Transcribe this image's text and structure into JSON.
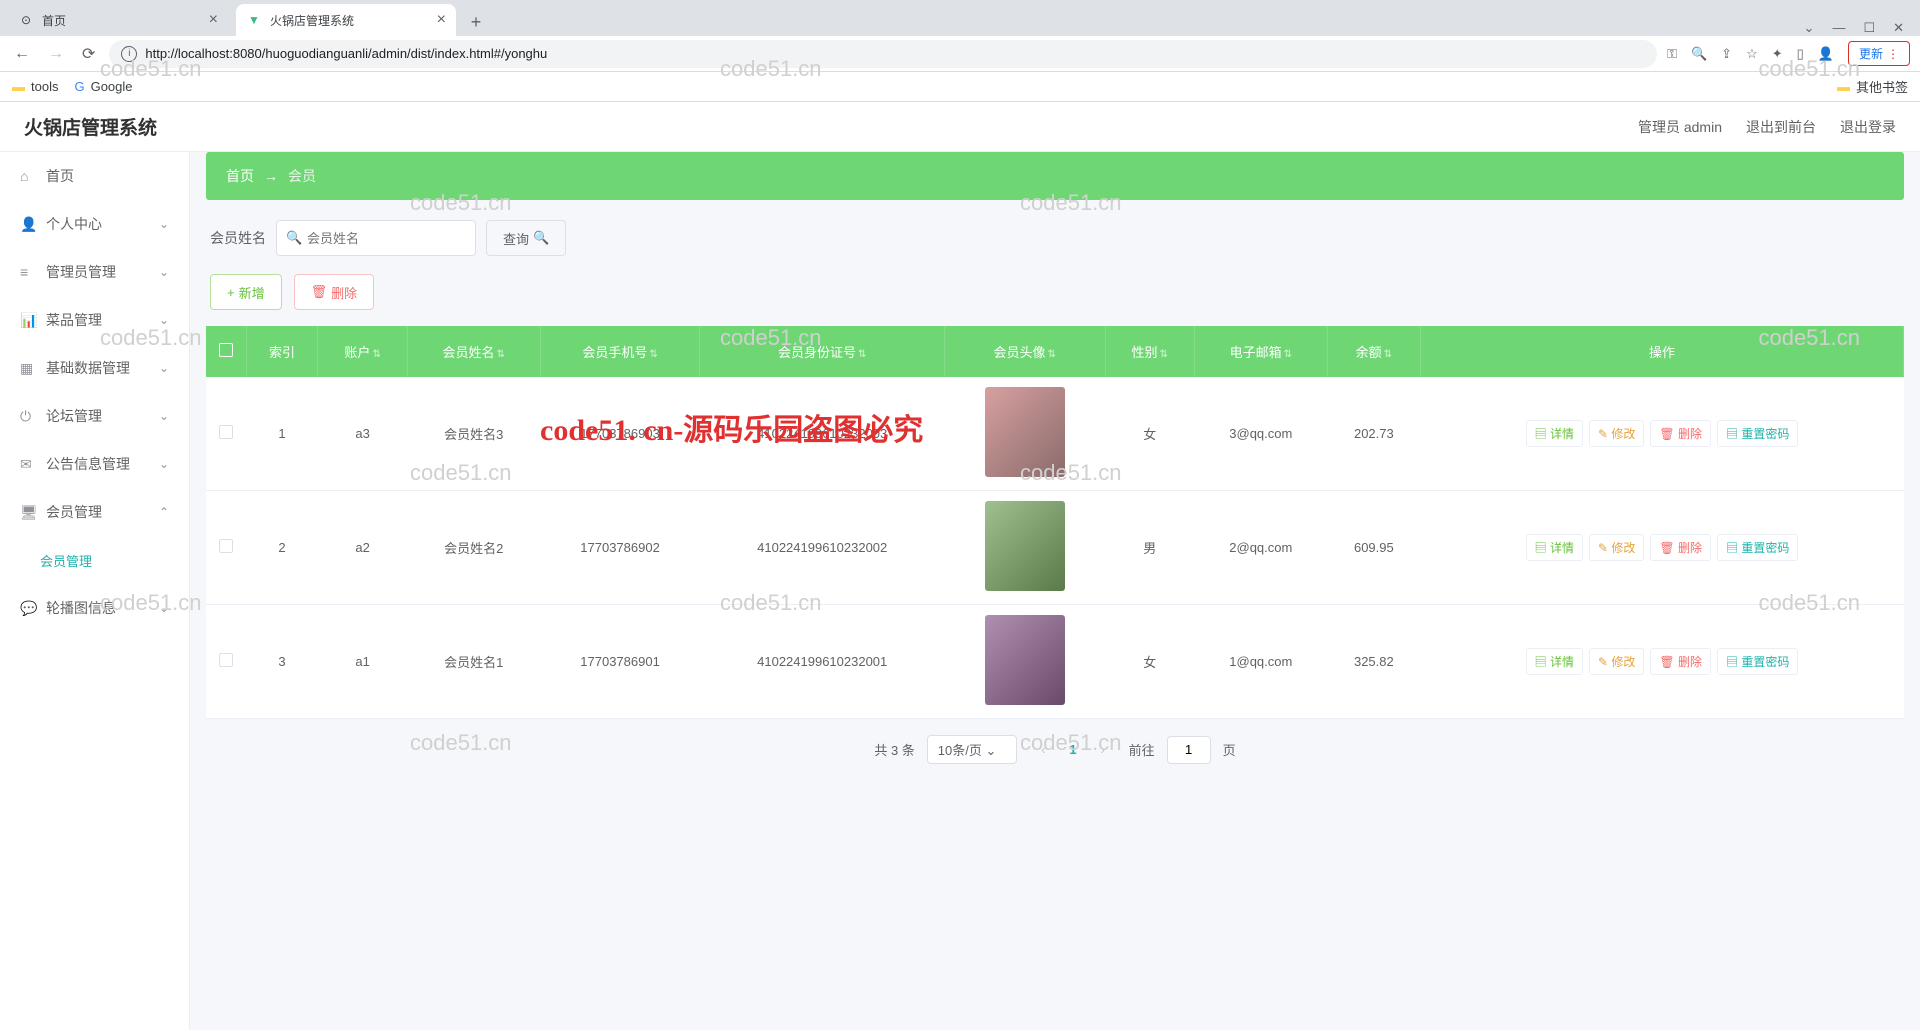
{
  "browser": {
    "tabs": [
      {
        "title": "首页",
        "active": false
      },
      {
        "title": "火锅店管理系统",
        "active": true
      }
    ],
    "url": "http://localhost:8080/huoguodianguanli/admin/dist/index.html#/yonghu",
    "update": "更新",
    "bookmarks": {
      "tools": "tools",
      "google": "Google",
      "other": "其他书签"
    }
  },
  "header": {
    "logo": "火锅店管理系统",
    "admin": "管理员 admin",
    "front": "退出到前台",
    "logout": "退出登录"
  },
  "sidebar": {
    "items": [
      {
        "icon": "⌂",
        "label": "首页",
        "chev": ""
      },
      {
        "icon": "👤",
        "label": "个人中心",
        "chev": "⌄"
      },
      {
        "icon": "≡",
        "label": "管理员管理",
        "chev": "⌄"
      },
      {
        "icon": "📊",
        "label": "菜品管理",
        "chev": "⌄"
      },
      {
        "icon": "▦",
        "label": "基础数据管理",
        "chev": "⌄"
      },
      {
        "icon": "⏻",
        "label": "论坛管理",
        "chev": "⌄"
      },
      {
        "icon": "✉",
        "label": "公告信息管理",
        "chev": "⌄"
      },
      {
        "icon": "🖥",
        "label": "会员管理",
        "chev": "⌃"
      },
      {
        "icon": "",
        "label": "会员管理",
        "chev": "",
        "sub": true
      },
      {
        "icon": "💬",
        "label": "轮播图信息",
        "chev": "⌄"
      }
    ]
  },
  "breadcrumb": {
    "home": "首页",
    "sep": "→",
    "current": "会员"
  },
  "search": {
    "label": "会员姓名",
    "placeholder": "会员姓名",
    "query": "查询"
  },
  "buttons": {
    "add": "新增",
    "delete": "删除"
  },
  "columns": [
    "",
    "索引",
    "账户",
    "会员姓名",
    "会员手机号",
    "会员身份证号",
    "会员头像",
    "性别",
    "电子邮箱",
    "余额",
    "操作"
  ],
  "rows": [
    {
      "idx": "1",
      "acct": "a3",
      "name": "会员姓名3",
      "phone": "17703786903",
      "idcard": "410224199610232003",
      "gender": "女",
      "email": "3@qq.com",
      "balance": "202.73"
    },
    {
      "idx": "2",
      "acct": "a2",
      "name": "会员姓名2",
      "phone": "17703786902",
      "idcard": "410224199610232002",
      "gender": "男",
      "email": "2@qq.com",
      "balance": "609.95"
    },
    {
      "idx": "3",
      "acct": "a1",
      "name": "会员姓名1",
      "phone": "17703786901",
      "idcard": "410224199610232001",
      "gender": "女",
      "email": "1@qq.com",
      "balance": "325.82"
    }
  ],
  "rowActions": {
    "detail": "详情",
    "edit": "修改",
    "del": "删除",
    "reset": "重置密码"
  },
  "pagination": {
    "total": "共 3 条",
    "perPage": "10条/页",
    "current": "1",
    "goto_pre": "前往",
    "goto_post": "页",
    "goto_val": "1"
  },
  "watermark": "code51.cn",
  "watermark_red": "code51. cn-源码乐园盗图必究"
}
